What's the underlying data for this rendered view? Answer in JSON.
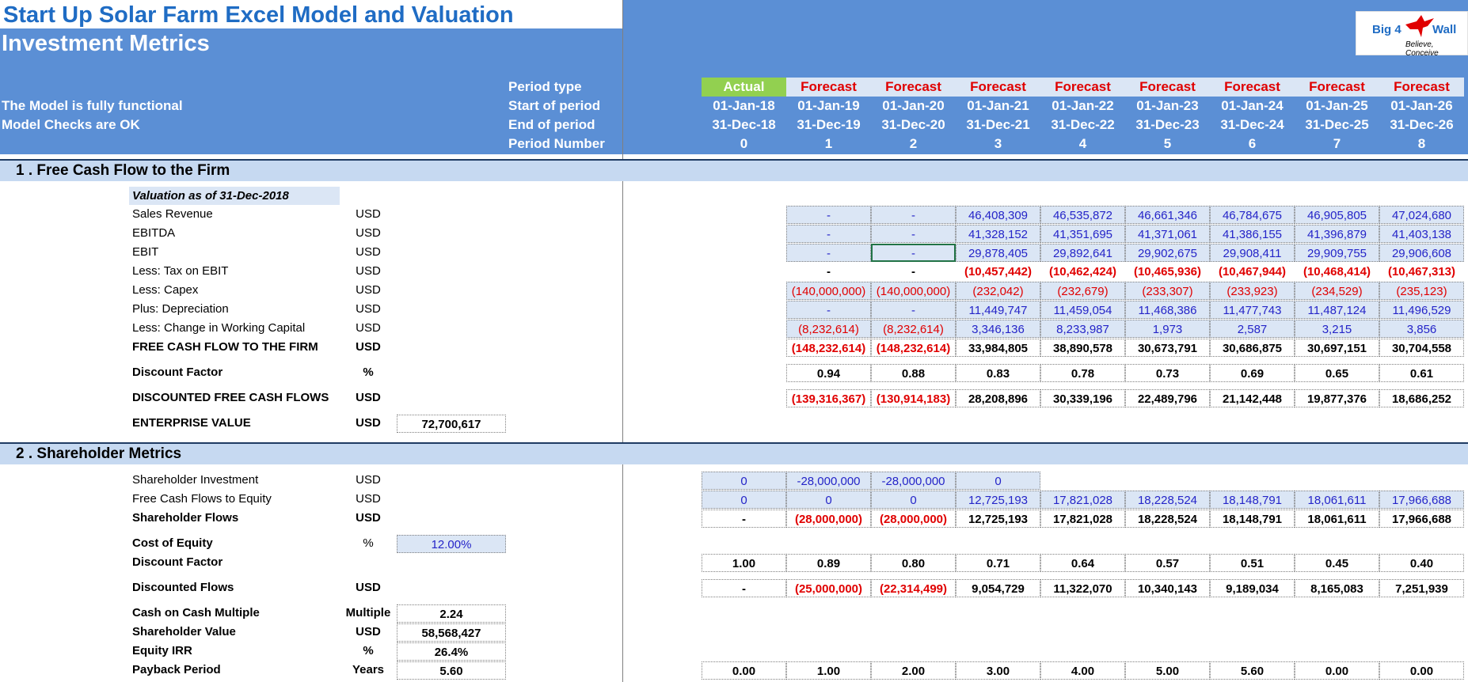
{
  "header": {
    "title": "Start Up Solar Farm Excel Model and Valuation",
    "subtitle": "Investment Metrics",
    "status1": "The Model is fully functional",
    "status2": "Model Checks are OK",
    "logo": {
      "text_left": "Big 4",
      "text_right": "Wall",
      "tagline": "Believe, Conceive"
    },
    "row_labels": [
      "Period type",
      "Start of period",
      "End of period",
      "Period Number"
    ],
    "periods": [
      {
        "type": "Actual",
        "start": "01-Jan-18",
        "end": "31-Dec-18",
        "num": "0"
      },
      {
        "type": "Forecast",
        "start": "01-Jan-19",
        "end": "31-Dec-19",
        "num": "1"
      },
      {
        "type": "Forecast",
        "start": "01-Jan-20",
        "end": "31-Dec-20",
        "num": "2"
      },
      {
        "type": "Forecast",
        "start": "01-Jan-21",
        "end": "31-Dec-21",
        "num": "3"
      },
      {
        "type": "Forecast",
        "start": "01-Jan-22",
        "end": "31-Dec-22",
        "num": "4"
      },
      {
        "type": "Forecast",
        "start": "01-Jan-23",
        "end": "31-Dec-23",
        "num": "5"
      },
      {
        "type": "Forecast",
        "start": "01-Jan-24",
        "end": "31-Dec-24",
        "num": "6"
      },
      {
        "type": "Forecast",
        "start": "01-Jan-25",
        "end": "31-Dec-25",
        "num": "7"
      },
      {
        "type": "Forecast",
        "start": "01-Jan-26",
        "end": "31-Dec-26",
        "num": "8"
      }
    ]
  },
  "colors": {
    "header_bg": "#5b8fd5",
    "section_bg": "#c6d9f1",
    "input_bg": "#dbe6f5",
    "actual": "#92d050",
    "negative": "#e00000",
    "input_text": "#2424c8",
    "title": "#1f6cc4"
  },
  "section1": {
    "title": "1 . Free Cash Flow to the Firm",
    "valuation_label": "Valuation as of 31-Dec-2018",
    "rows": [
      {
        "label": "Sales Revenue",
        "unit": "USD",
        "values": [
          "-",
          "-",
          "46,408,309",
          "46,535,872",
          "46,661,346",
          "46,784,675",
          "46,905,805",
          "47,024,680"
        ]
      },
      {
        "label": "EBITDA",
        "unit": "USD",
        "values": [
          "-",
          "-",
          "41,328,152",
          "41,351,695",
          "41,371,061",
          "41,386,155",
          "41,396,879",
          "41,403,138"
        ]
      },
      {
        "label": "EBIT",
        "unit": "USD",
        "values": [
          "-",
          "-",
          "29,878,405",
          "29,892,641",
          "29,902,675",
          "29,908,411",
          "29,909,755",
          "29,906,608"
        ]
      },
      {
        "label": "Less: Tax on EBIT",
        "unit": "USD",
        "values": [
          "-",
          "-",
          "(10,457,442)",
          "(10,462,424)",
          "(10,465,936)",
          "(10,467,944)",
          "(10,468,414)",
          "(10,467,313)"
        ]
      },
      {
        "label": "Less: Capex",
        "unit": "USD",
        "values": [
          "(140,000,000)",
          "(140,000,000)",
          "(232,042)",
          "(232,679)",
          "(233,307)",
          "(233,923)",
          "(234,529)",
          "(235,123)"
        ]
      },
      {
        "label": "Plus: Depreciation",
        "unit": "USD",
        "values": [
          "-",
          "-",
          "11,449,747",
          "11,459,054",
          "11,468,386",
          "11,477,743",
          "11,487,124",
          "11,496,529"
        ]
      },
      {
        "label": "Less: Change in Working Capital",
        "unit": "USD",
        "values": [
          "(8,232,614)",
          "(8,232,614)",
          "3,346,136",
          "8,233,987",
          "1,973",
          "2,587",
          "3,215",
          "3,856"
        ]
      },
      {
        "label": "FREE CASH FLOW TO THE FIRM",
        "unit": "USD",
        "values": [
          "(148,232,614)",
          "(148,232,614)",
          "33,984,805",
          "38,890,578",
          "30,673,791",
          "30,686,875",
          "30,697,151",
          "30,704,558"
        ]
      }
    ],
    "discount_factor": {
      "label": "Discount Factor",
      "unit": "%",
      "values": [
        "0.94",
        "0.88",
        "0.83",
        "0.78",
        "0.73",
        "0.69",
        "0.65",
        "0.61"
      ]
    },
    "discounted_fcf": {
      "label": "DISCOUNTED FREE CASH FLOWS",
      "unit": "USD",
      "values": [
        "(139,316,367)",
        "(130,914,183)",
        "28,208,896",
        "30,339,196",
        "22,489,796",
        "21,142,448",
        "19,877,376",
        "18,686,252"
      ]
    },
    "enterprise_value": {
      "label": "ENTERPRISE VALUE",
      "unit": "USD",
      "value": "72,700,617"
    }
  },
  "section2": {
    "title": "2 . Shareholder Metrics",
    "shareholder_investment": {
      "label": "Shareholder Investment",
      "unit": "USD",
      "values": [
        "0",
        "-28,000,000",
        "-28,000,000",
        "0"
      ]
    },
    "fcfe": {
      "label": "Free Cash Flows to Equity",
      "unit": "USD",
      "values": [
        "0",
        "0",
        "0",
        "12,725,193",
        "17,821,028",
        "18,228,524",
        "18,148,791",
        "18,061,611",
        "17,966,688"
      ]
    },
    "shareholder_flows": {
      "label": "Shareholder Flows",
      "unit": "USD",
      "values": [
        "-",
        "(28,000,000)",
        "(28,000,000)",
        "12,725,193",
        "17,821,028",
        "18,228,524",
        "18,148,791",
        "18,061,611",
        "17,966,688"
      ]
    },
    "cost_of_equity": {
      "label": "Cost of Equity",
      "unit": "%",
      "value": "12.00%"
    },
    "discount_factor": {
      "label": "Discount Factor",
      "values": [
        "1.00",
        "0.89",
        "0.80",
        "0.71",
        "0.64",
        "0.57",
        "0.51",
        "0.45",
        "0.40"
      ]
    },
    "discounted_flows": {
      "label": "Discounted Flows",
      "unit": "USD",
      "values": [
        "-",
        "(25,000,000)",
        "(22,314,499)",
        "9,054,729",
        "11,322,070",
        "10,340,143",
        "9,189,034",
        "8,165,083",
        "7,251,939"
      ]
    },
    "cash_multiple": {
      "label": "Cash on Cash Multiple",
      "unit": "Multiple",
      "value": "2.24"
    },
    "shareholder_value": {
      "label": "Shareholder Value",
      "unit": "USD",
      "value": "58,568,427"
    },
    "equity_irr": {
      "label": "Equity IRR",
      "unit": "%",
      "value": "26.4%"
    },
    "payback": {
      "label": "Payback Period",
      "unit": "Years",
      "value": "5.60",
      "values": [
        "0.00",
        "1.00",
        "2.00",
        "3.00",
        "4.00",
        "5.00",
        "5.60",
        "0.00",
        "0.00"
      ]
    }
  }
}
